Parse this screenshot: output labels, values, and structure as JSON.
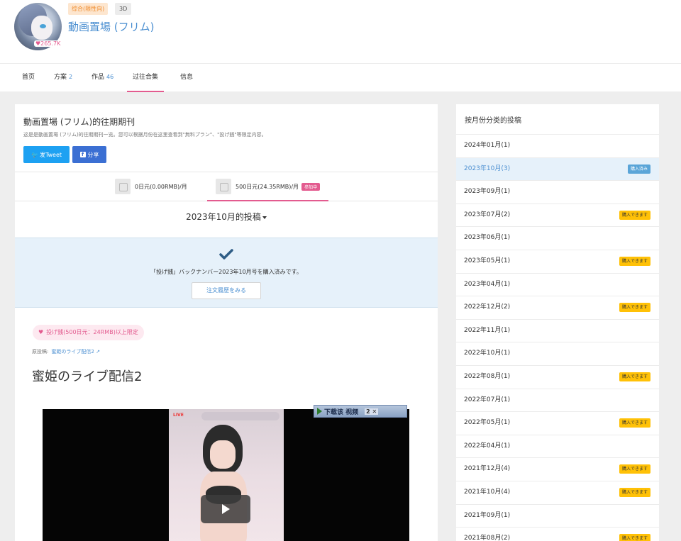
{
  "creator": {
    "tag_adult": "综合(限性向)",
    "tag_3d": "3D",
    "name": "動画置場 (フリム)",
    "likes": "265.7K"
  },
  "tabs": [
    {
      "label": "首页",
      "count": ""
    },
    {
      "label": "方案",
      "count": "2"
    },
    {
      "label": "作品",
      "count": "46"
    },
    {
      "label": "过往合集",
      "count": ""
    },
    {
      "label": "信息",
      "count": ""
    }
  ],
  "main": {
    "title": "動画置場 (フリム)的往期期刊",
    "description": "这是是動画置場 (フリム)的往期期刊一览。您可以根据月份在这里查看到\"無料プラン\"、\"投げ銭\"等限定内容。",
    "tweet_label": "发Tweet",
    "share_label": "分享",
    "plans": [
      {
        "label": "0日元(0.00RMB)/月",
        "badge": ""
      },
      {
        "label": "500日元(24.35RMB)/月",
        "badge": "参加中"
      }
    ],
    "month_heading": "2023年10月的投稿",
    "purchased_text": "「投げ銭」バックナンバー2023年10月号を購入済みです。",
    "orders_button": "注文履歴をみる",
    "post_badge": "投げ銭(500日元：24RMB)以上限定",
    "source_label": "原投稿:",
    "source_link": "蜜姫のライブ配信2",
    "post_title": "蜜姫のライブ配信2",
    "video_live": "LIVE",
    "download_label": "下载该 视频",
    "download_extra": "2 ✕"
  },
  "sidebar": {
    "title": "按月份分类的投稿",
    "months": [
      {
        "label": "2024年01月(1)",
        "badge": "",
        "badge_type": ""
      },
      {
        "label": "2023年10月(3)",
        "badge": "購入済み",
        "badge_type": "bought"
      },
      {
        "label": "2023年09月(1)",
        "badge": "",
        "badge_type": ""
      },
      {
        "label": "2023年07月(2)",
        "badge": "購入できます",
        "badge_type": "can"
      },
      {
        "label": "2023年06月(1)",
        "badge": "",
        "badge_type": ""
      },
      {
        "label": "2023年05月(1)",
        "badge": "購入できます",
        "badge_type": "can"
      },
      {
        "label": "2023年04月(1)",
        "badge": "",
        "badge_type": ""
      },
      {
        "label": "2022年12月(2)",
        "badge": "購入できます",
        "badge_type": "can"
      },
      {
        "label": "2022年11月(1)",
        "badge": "",
        "badge_type": ""
      },
      {
        "label": "2022年10月(1)",
        "badge": "",
        "badge_type": ""
      },
      {
        "label": "2022年08月(1)",
        "badge": "購入できます",
        "badge_type": "can"
      },
      {
        "label": "2022年07月(1)",
        "badge": "",
        "badge_type": ""
      },
      {
        "label": "2022年05月(1)",
        "badge": "購入できます",
        "badge_type": "can"
      },
      {
        "label": "2022年04月(1)",
        "badge": "",
        "badge_type": ""
      },
      {
        "label": "2021年12月(4)",
        "badge": "購入できます",
        "badge_type": "can"
      },
      {
        "label": "2021年10月(4)",
        "badge": "購入できます",
        "badge_type": "can"
      },
      {
        "label": "2021年09月(1)",
        "badge": "",
        "badge_type": ""
      },
      {
        "label": "2021年08月(2)",
        "badge": "購入できます",
        "badge_type": "can"
      }
    ]
  },
  "colors": {
    "accent_pink": "#e35b8f",
    "link_blue": "#4b8fd1",
    "badge_yellow": "#ffc107",
    "badge_blue": "#5aa5d8"
  }
}
